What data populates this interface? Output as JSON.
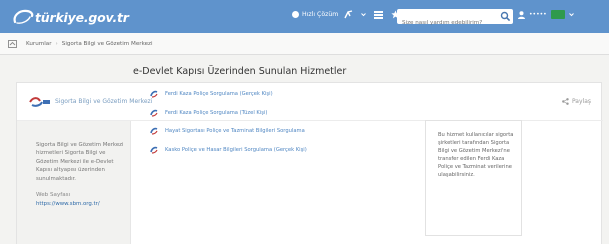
{
  "header": {
    "logo_text": "türkiye.gov.tr",
    "help_label": "Hızlı Çözüm",
    "search_placeholder": "Size nasıl yardım edebilirim?",
    "user_name": "•••••"
  },
  "breadcrumb": {
    "items": [
      "Kurumlar",
      "Sigorta Bilgi ve Gözetim Merkezi"
    ]
  },
  "institution": {
    "name": "Sigorta Bilgi ve Gözetim Merkezi",
    "share_label": "Paylaş"
  },
  "sidebar": {
    "description": "Sigorta Bilgi ve Gözetim Merkezi hizmetleri Sigorta Bilgi ve Gözetim Merkezi ile e-Devlet Kapısı altyapısı üzerinden sunulmaktadır.",
    "web_label": "Web Sayfası",
    "web_link": "https://www.sbm.org.tr/"
  },
  "main": {
    "title": "e-Devlet Kapısı Üzerinden Sunulan Hizmetler",
    "services": [
      "Ferdi Kaza Poliçe Sorgulama (Gerçek Kişi)",
      "Ferdi Kaza Poliçe Sorgulama (Tüzel Kişi)",
      "Hayat Sigortası Poliçe ve Tazminat Bilgileri Sorgulama",
      "Kasko Poliçe ve Hasar Bilgileri Sorgulama (Gerçek Kişi)"
    ]
  },
  "info_box": {
    "text": "Bu hizmet kullanıcılar sigorta şirketleri tarafından Sigorta Bilgi ve Gözetim Merkezi'ne transfer edilen Ferdi Kaza Poliçe ve Tazminat verilerine ulaşabilirsiniz."
  },
  "colors": {
    "topbar": "#5f93cc",
    "link": "#4f86c2",
    "flag": "#2f9a4c"
  }
}
